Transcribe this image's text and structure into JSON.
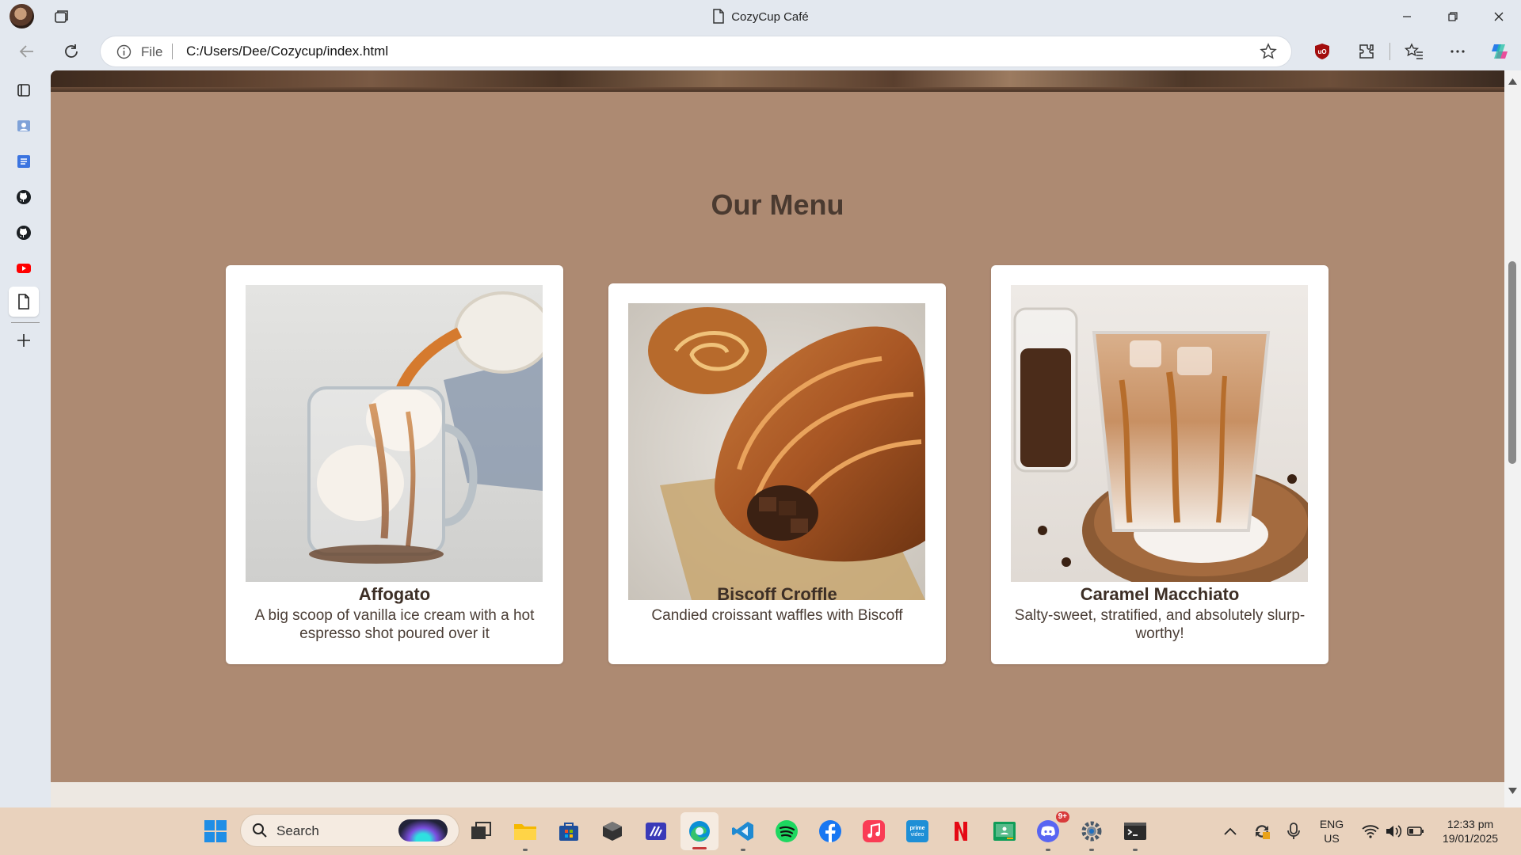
{
  "browser": {
    "tab_title": "CozyCup Café",
    "address_scheme": "File",
    "address_url": "C:/Users/Dee/Cozycup/index.html"
  },
  "page": {
    "menu_heading": "Our Menu",
    "items": [
      {
        "name": "Affogato",
        "description": "A big scoop of vanilla ice cream with a hot espresso shot poured over it"
      },
      {
        "name": "Biscoff Croffle",
        "description": "Candied croissant waffles with Biscoff"
      },
      {
        "name": "Caramel Macchiato",
        "description": "Salty-sweet, stratified, and absolutely slurp-worthy!"
      }
    ]
  },
  "taskbar": {
    "search_placeholder": "Search",
    "language": "ENG",
    "region": "US",
    "time": "12:33 pm",
    "date": "19/01/2025",
    "discord_badge": "9+"
  },
  "colors": {
    "page_background": "#ad8a72",
    "card_background": "#ffffff",
    "heading": "#4a3a30",
    "taskbar": "#e9d2bd"
  },
  "icons": {
    "sidebar": [
      "tabs-icon",
      "contacts-icon",
      "docs-icon",
      "github-icon",
      "github-icon",
      "youtube-icon",
      "file-icon",
      "add-icon"
    ],
    "taskbar": [
      "windows-start-icon",
      "search-icon",
      "task-view-icon",
      "file-explorer-icon",
      "microsoft-store-icon",
      "app-icon",
      "visual-studio-icon",
      "edge-icon",
      "vscode-icon",
      "spotify-icon",
      "facebook-icon",
      "apple-music-icon",
      "prime-video-icon",
      "netflix-icon",
      "google-classroom-icon",
      "discord-icon",
      "settings-icon",
      "terminal-icon"
    ]
  }
}
